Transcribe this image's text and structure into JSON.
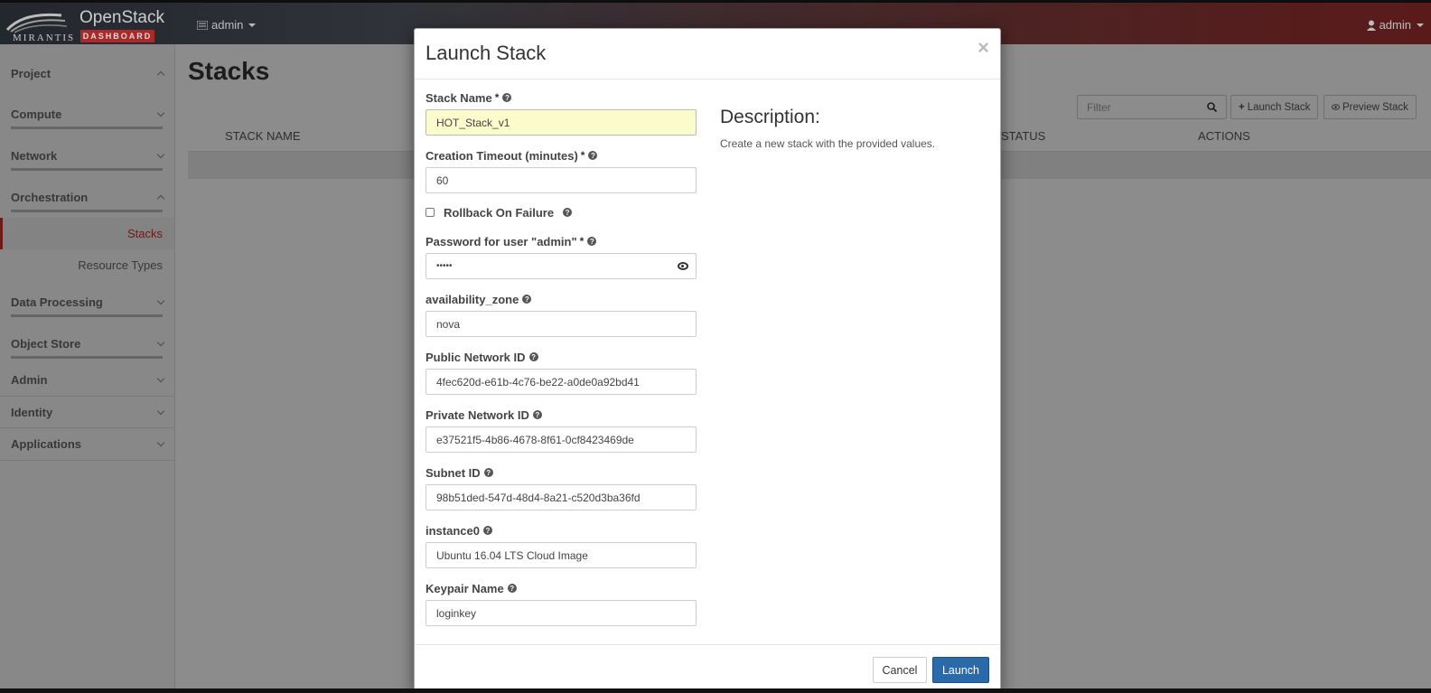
{
  "header": {
    "brand_top": "OpenStack",
    "brand_badge": "DASHBOARD",
    "brand_vendor": "MIRANTIS",
    "project_menu": "admin",
    "user_menu": "admin"
  },
  "sidebar": {
    "items": [
      {
        "label": "Project"
      },
      {
        "label": "Compute"
      },
      {
        "label": "Network"
      },
      {
        "label": "Orchestration"
      },
      {
        "label": "Stacks"
      },
      {
        "label": "Resource Types"
      },
      {
        "label": "Data Processing"
      },
      {
        "label": "Object Store"
      },
      {
        "label": "Admin"
      },
      {
        "label": "Identity"
      },
      {
        "label": "Applications"
      }
    ]
  },
  "main": {
    "title": "Stacks",
    "filter_placeholder": "Filter",
    "launch_stack_button": "Launch Stack",
    "preview_stack_button": "Preview Stack",
    "columns": [
      "STACK NAME",
      "STATUS",
      "ACTIONS"
    ]
  },
  "modal": {
    "title": "Launch Stack",
    "close_symbol": "×",
    "fields": {
      "stack_name": {
        "label": "Stack Name",
        "required": "*",
        "value": "HOT_Stack_v1"
      },
      "timeout": {
        "label": "Creation Timeout (minutes)",
        "required": "*",
        "value": "60"
      },
      "rollback": {
        "label": "Rollback On Failure",
        "checked": false
      },
      "password": {
        "label": "Password for user \"admin\"",
        "required": "*",
        "value": "•••••"
      },
      "availability_zone": {
        "label": "availability_zone",
        "value": "nova"
      },
      "public_network": {
        "label": "Public Network ID",
        "value": "4fec620d-e61b-4c76-be22-a0de0a92bd41"
      },
      "private_network": {
        "label": "Private Network ID",
        "value": "e37521f5-4b86-4678-8f61-0cf8423469de"
      },
      "subnet": {
        "label": "Subnet ID",
        "value": "98b51ded-547d-48d4-8a21-c520d3ba36fd"
      },
      "instance0": {
        "label": "instance0",
        "value": "Ubuntu 16.04 LTS Cloud Image"
      },
      "keypair": {
        "label": "Keypair Name",
        "value": "loginkey"
      }
    },
    "description_title": "Description:",
    "description_text": "Create a new stack with the provided values.",
    "cancel_button": "Cancel",
    "launch_button": "Launch"
  },
  "colors": {
    "accent_red": "#c7322f",
    "primary_blue": "#2a6aa8",
    "focused_input": "#fbfccb"
  }
}
